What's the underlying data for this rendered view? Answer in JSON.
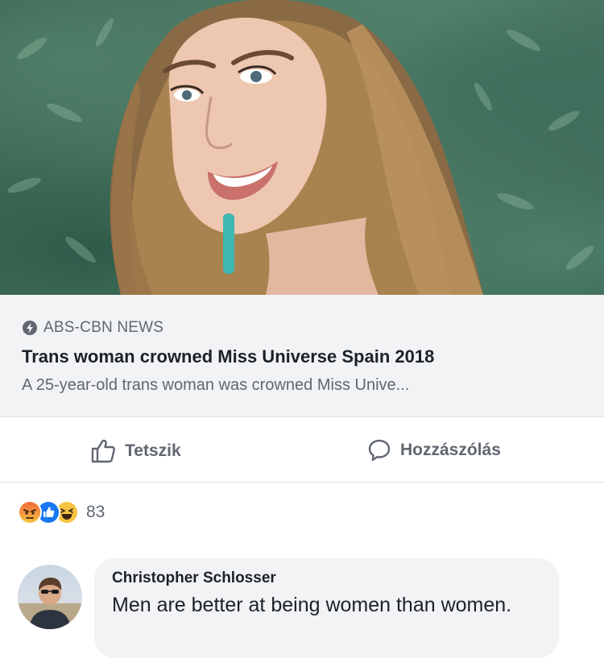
{
  "post": {
    "image": {
      "subject": "photo-of-smiling-woman"
    },
    "link": {
      "source": "ABS-CBN NEWS",
      "headline": "Trans woman crowned Miss Universe Spain 2018",
      "description": "A 25-year-old trans woman was crowned Miss Unive..."
    },
    "actions": {
      "like_label": "Tetszik",
      "comment_label": "Hozzászólás"
    },
    "reactions": {
      "icons": [
        "angry-reaction-icon",
        "like-reaction-icon",
        "haha-reaction-icon"
      ],
      "count": "83"
    },
    "comment": {
      "author": "Christopher Schlosser",
      "text": "Men are better at being women than women."
    }
  },
  "colors": {
    "link_box_bg": "#f2f3f5",
    "muted_text": "#606770",
    "like_blue": "#1877f2",
    "angry_orange": "#f0693c",
    "haha_yellow": "#f7c33f"
  }
}
